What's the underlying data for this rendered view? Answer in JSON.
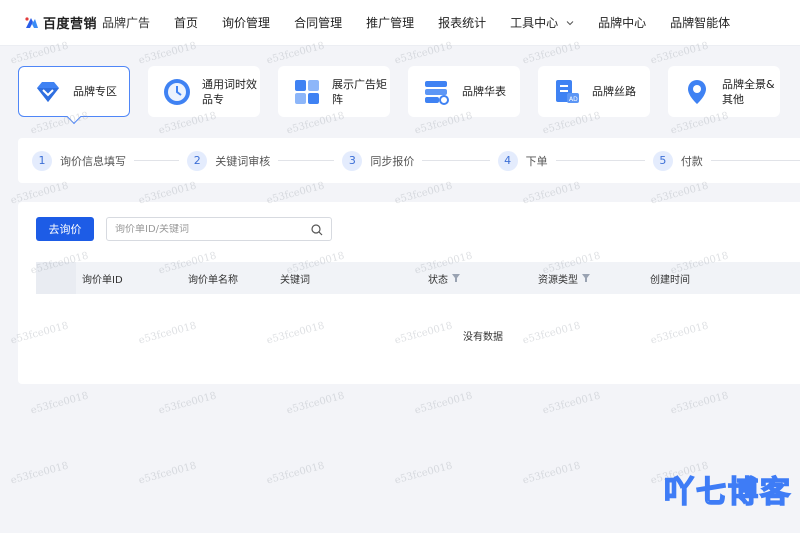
{
  "header": {
    "logo_text": "百度营销",
    "logo_sub": "品牌广告",
    "nav": [
      "首页",
      "询价管理",
      "合同管理",
      "推广管理",
      "报表统计",
      "工具中心",
      "品牌中心",
      "品牌智能体"
    ],
    "tools_has_dropdown": true
  },
  "cards": [
    {
      "label": "品牌专区",
      "icon": "diamond-icon",
      "active": true
    },
    {
      "label": "通用词时效品专",
      "icon": "clock-icon",
      "active": false
    },
    {
      "label": "展示广告矩阵",
      "icon": "grid-icon",
      "active": false
    },
    {
      "label": "品牌华表",
      "icon": "layers-search-icon",
      "active": false
    },
    {
      "label": "品牌丝路",
      "icon": "ad-document-icon",
      "active": false
    },
    {
      "label": "品牌全景&其他",
      "icon": "location-pin-icon",
      "active": false
    }
  ],
  "steps": [
    {
      "num": "1",
      "label": "询价信息填写"
    },
    {
      "num": "2",
      "label": "关键词审核"
    },
    {
      "num": "3",
      "label": "同步报价"
    },
    {
      "num": "4",
      "label": "下单"
    },
    {
      "num": "5",
      "label": "付款"
    }
  ],
  "toolbar": {
    "inquiry_button": "去询价",
    "search_placeholder": "询价单ID/关键词"
  },
  "table": {
    "columns": [
      {
        "label": "询价单ID",
        "filter": false
      },
      {
        "label": "询价单名称",
        "filter": false
      },
      {
        "label": "关键词",
        "filter": false
      },
      {
        "label": "状态",
        "filter": true
      },
      {
        "label": "资源类型",
        "filter": true
      },
      {
        "label": "创建时间",
        "filter": false
      }
    ],
    "empty_text": "没有数据"
  },
  "watermark_text": "e53fce0018",
  "corner_brand": "吖七博客",
  "colors": {
    "primary": "#1d5ce6",
    "active_border": "#4f86f7",
    "step_bg": "#e4ecfd",
    "page_bg": "#f3f4f8"
  }
}
